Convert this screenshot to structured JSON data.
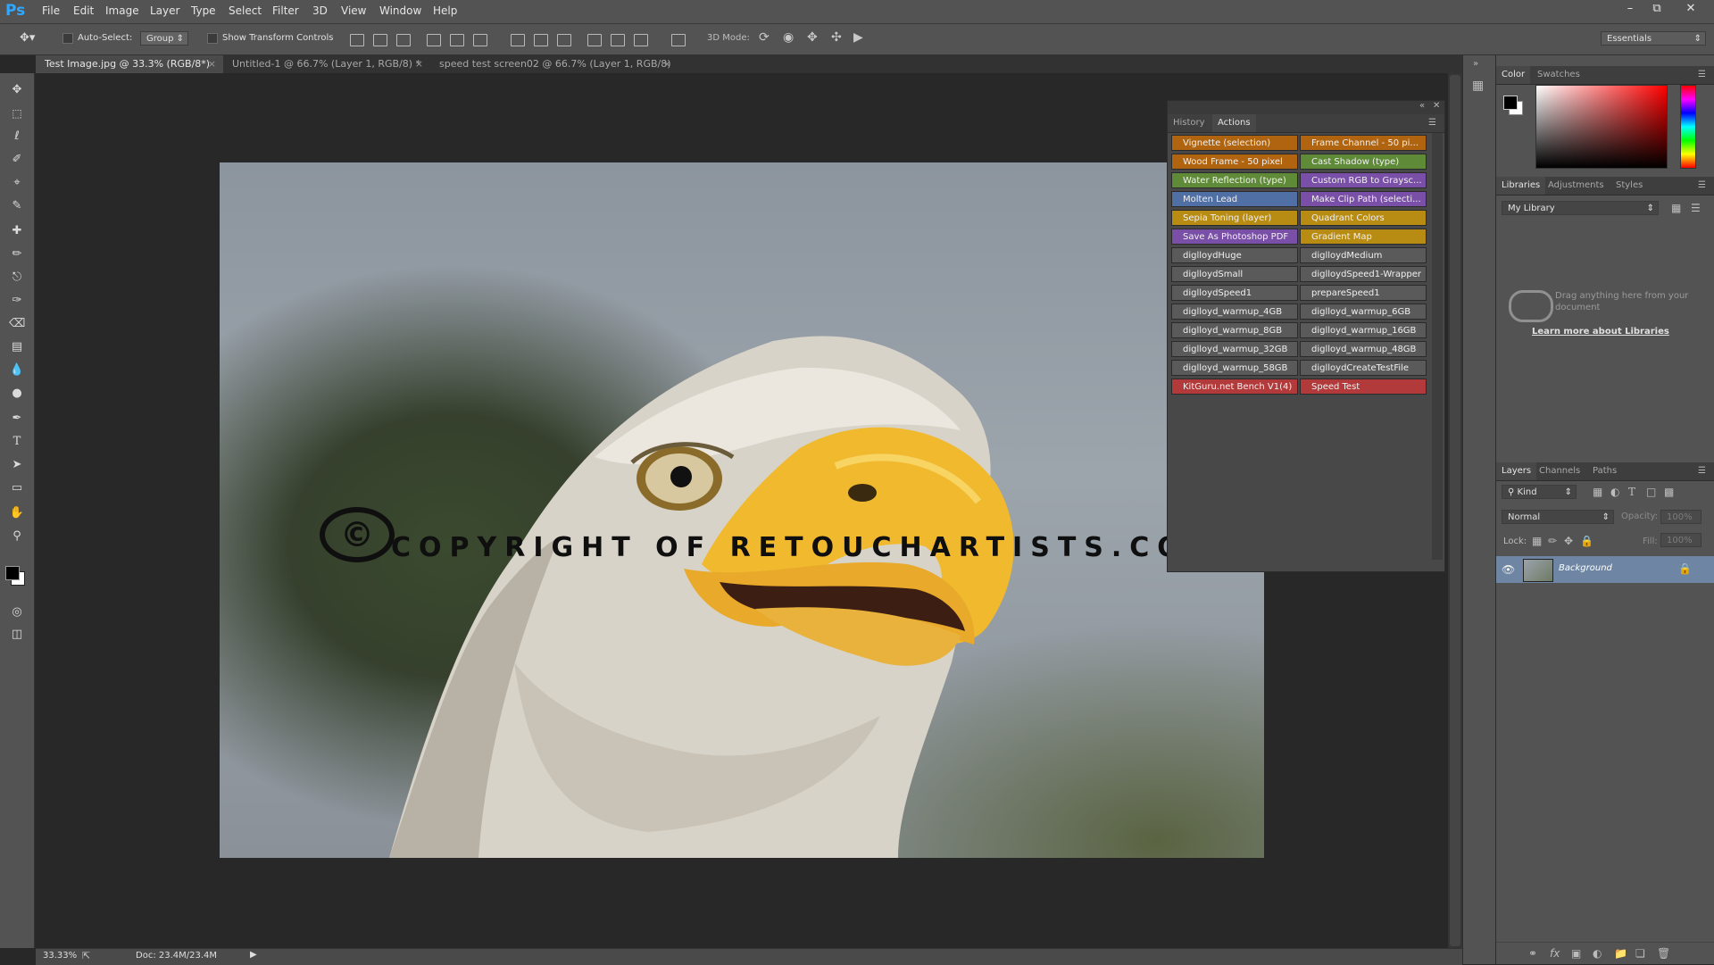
{
  "app": {
    "logo": "Ps"
  },
  "menu": [
    "File",
    "Edit",
    "Image",
    "Layer",
    "Type",
    "Select",
    "Filter",
    "3D",
    "View",
    "Window",
    "Help"
  ],
  "options_bar": {
    "auto_select_label": "Auto-Select:",
    "auto_select_value": "Group",
    "show_transform_label": "Show Transform Controls",
    "mode_3d_label": "3D Mode:",
    "workspace": "Essentials"
  },
  "tabs": [
    {
      "label": "Test Image.jpg @ 33.3% (RGB/8*)",
      "close": "×"
    },
    {
      "label": "Untitled-1 @ 66.7% (Layer 1, RGB/8) *",
      "close": "×"
    },
    {
      "label": "speed test screen02 @ 66.7% (Layer 1, RGB/8) *",
      "close": "×"
    }
  ],
  "canvas": {
    "watermark_symbol": "©",
    "watermark_text": "COPYRIGHT OF RETOUCHARTISTS.COM"
  },
  "status": {
    "zoom": "33.33%",
    "doc": "Doc: 23.4M/23.4M"
  },
  "actions_panel": {
    "tabs": [
      "History",
      "Actions"
    ],
    "active_tab": "Actions",
    "items": [
      {
        "label": "Vignette (selection)",
        "color": "#b0640f"
      },
      {
        "label": "Frame Channel - 50 pi...",
        "color": "#b0640f"
      },
      {
        "label": "Wood Frame - 50 pixel",
        "color": "#b0640f"
      },
      {
        "label": "Cast Shadow (type)",
        "color": "#5f8b38"
      },
      {
        "label": "Water Reflection (type)",
        "color": "#5f8b38"
      },
      {
        "label": "Custom RGB to Graysc...",
        "color": "#7a4fa7"
      },
      {
        "label": "Molten Lead",
        "color": "#4f6fa5"
      },
      {
        "label": "Make Clip Path (selecti...",
        "color": "#7a4fa7"
      },
      {
        "label": "Sepia Toning (layer)",
        "color": "#b88b12"
      },
      {
        "label": "Quadrant Colors",
        "color": "#b88b12"
      },
      {
        "label": "Save As Photoshop PDF",
        "color": "#7a4fa7"
      },
      {
        "label": "Gradient Map",
        "color": "#b88b12"
      },
      {
        "label": "diglloydHuge",
        "color": "#5a5a5a"
      },
      {
        "label": "diglloydMedium",
        "color": "#5a5a5a"
      },
      {
        "label": "diglloydSmall",
        "color": "#5a5a5a"
      },
      {
        "label": "diglloydSpeed1-Wrapper",
        "color": "#5a5a5a"
      },
      {
        "label": "diglloydSpeed1",
        "color": "#5a5a5a"
      },
      {
        "label": "prepareSpeed1",
        "color": "#5a5a5a"
      },
      {
        "label": "diglloyd_warmup_4GB",
        "color": "#5a5a5a"
      },
      {
        "label": "diglloyd_warmup_6GB",
        "color": "#5a5a5a"
      },
      {
        "label": "diglloyd_warmup_8GB",
        "color": "#5a5a5a"
      },
      {
        "label": "diglloyd_warmup_16GB",
        "color": "#5a5a5a"
      },
      {
        "label": "diglloyd_warmup_32GB",
        "color": "#5a5a5a"
      },
      {
        "label": "diglloyd_warmup_48GB",
        "color": "#5a5a5a"
      },
      {
        "label": "diglloyd_warmup_58GB",
        "color": "#5a5a5a"
      },
      {
        "label": "diglloydCreateTestFile",
        "color": "#5a5a5a"
      },
      {
        "label": "KitGuru.net Bench V1(4)",
        "color": "#b33a3a"
      },
      {
        "label": "Speed Test",
        "color": "#b33a3a"
      }
    ]
  },
  "color_panel": {
    "tabs": [
      "Color",
      "Swatches"
    ]
  },
  "libraries_panel": {
    "tabs": [
      "Libraries",
      "Adjustments",
      "Styles"
    ],
    "library": "My Library",
    "drag_hint": "Drag anything here from your document",
    "learn_more": "Learn more about Libraries"
  },
  "layers_panel": {
    "tabs": [
      "Layers",
      "Channels",
      "Paths"
    ],
    "kind_label": "Kind",
    "blend_mode": "Normal",
    "opacity_label": "Opacity:",
    "opacity_value": "100%",
    "lock_label": "Lock:",
    "fill_label": "Fill:",
    "fill_value": "100%",
    "layers": [
      {
        "name": "Background"
      }
    ]
  },
  "colors": {
    "accent": "#31a8ff",
    "foreground": "#000000",
    "background": "#ffffff"
  }
}
